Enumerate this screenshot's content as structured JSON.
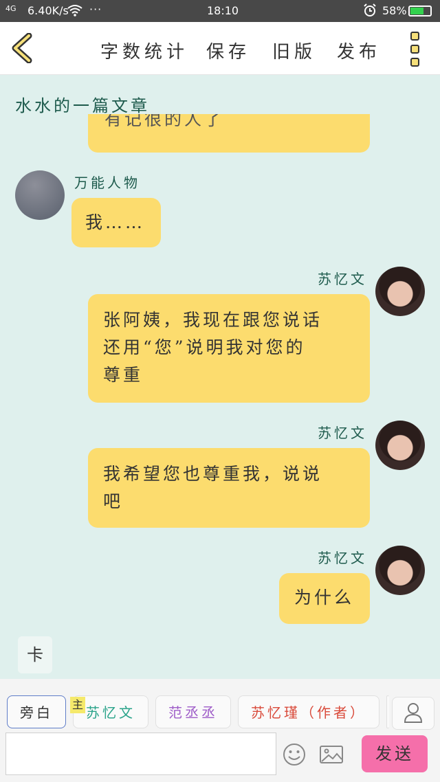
{
  "status_bar": {
    "signal": "4G",
    "speed": "6.40K/s",
    "more": "···",
    "time": "18:10",
    "battery": "58%",
    "battery_level": 0.58,
    "icons": [
      "signal-icon",
      "wifi-icon",
      "alarm-icon",
      "battery-icon"
    ]
  },
  "header": {
    "buttons": {
      "word_count": "字数统计",
      "save": "保存",
      "old_version": "旧版",
      "publish": "发布"
    },
    "back_icon": "back-chevron-icon",
    "menu_icon": "menu-icon"
  },
  "doc": {
    "title": "水水的一篇文章"
  },
  "messages": {
    "partial_top": "有记很的人了",
    "m1": {
      "name": "万能人物",
      "text": "我……"
    },
    "m2": {
      "name": "苏忆文",
      "line1": "张阿姨，我现在跟您说话",
      "line2": "还用“您”说明我对您的",
      "line3": "尊重"
    },
    "m3": {
      "name": "苏忆文",
      "line1": "我希望您也尊重我，说说",
      "line2": "吧"
    },
    "m4": {
      "name": "苏忆文",
      "text": "为什么"
    }
  },
  "card_button": "卡",
  "roles": {
    "narration": "旁白",
    "main_tag": "主",
    "su": "苏忆文",
    "fan": "范丞丞",
    "sujin": "苏忆瑾（作者）"
  },
  "composer": {
    "placeholder": "",
    "send": "发送"
  },
  "colors": {
    "background": "#dff0ed",
    "bubble": "#fcdc6e",
    "send_button": "#f56faa",
    "name_text": "#1d5a4c"
  }
}
